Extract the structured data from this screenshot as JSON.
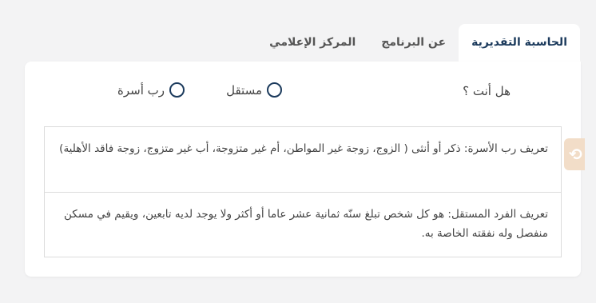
{
  "tabs": [
    {
      "label": "الحاسبة التقديرية",
      "active": true
    },
    {
      "label": "عن البرنامج",
      "active": false
    },
    {
      "label": "المركز الإعلامي",
      "active": false
    }
  ],
  "form": {
    "question": "هل أنت ؟",
    "options": [
      {
        "label": "مستقل",
        "checked": false
      },
      {
        "label": "رب أسرة",
        "checked": false
      }
    ]
  },
  "definitions": [
    {
      "text": "تعريف رب الأسرة: ذكر أو أنثى ( الزوج، زوجة غير المواطن، أم غير متزوجة، أب غير متزوج، زوجة فاقد الأهلية)"
    },
    {
      "text": "تعريف الفرد المستقل: هو كل شخص تبلغ سنّه ثمانية عشر عاما أو أكثر ولا يوجد لديه تابعين، ويقيم في مسكن منفصل وله نفقته الخاصة به."
    }
  ],
  "side_widget": {
    "icon": "accessibility-icon",
    "color": "#f2ddc8"
  },
  "colors": {
    "accent": "#1b3a5c",
    "background": "#f3f3f4",
    "card": "#ffffff"
  }
}
